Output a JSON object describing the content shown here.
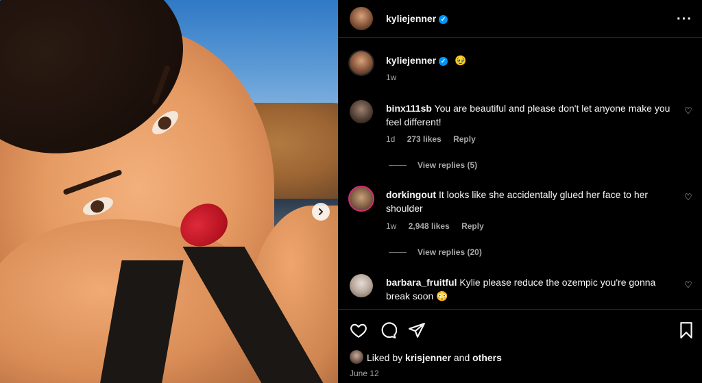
{
  "post": {
    "author": "kyliejenner",
    "time_ago": "1w",
    "emoji": "🥹",
    "next_icon": "chevron-right-icon"
  },
  "comments": [
    {
      "username": "binx111sb",
      "text": "You are beautiful and please don't let anyone make you feel different!",
      "time": "1d",
      "likes": "273 likes",
      "reply": "Reply",
      "view_replies": "View replies (5)"
    },
    {
      "username": "dorkingout",
      "text": "It looks like she accidentally glued her face to her shoulder",
      "time": "1w",
      "likes": "2,948 likes",
      "reply": "Reply",
      "view_replies": "View replies (20)"
    },
    {
      "username": "barbara_fruitful",
      "text": "Kylie please reduce the ozempic you're gonna break soon 😳"
    }
  ],
  "footer": {
    "liked_by_prefix": "Liked by",
    "liked_by_user": "krisjenner",
    "and": "and",
    "others": "others",
    "date": "June 12"
  },
  "colors": {
    "verified": "#0095f6",
    "secondary_text": "#a8a8a8",
    "divider": "#262626"
  }
}
